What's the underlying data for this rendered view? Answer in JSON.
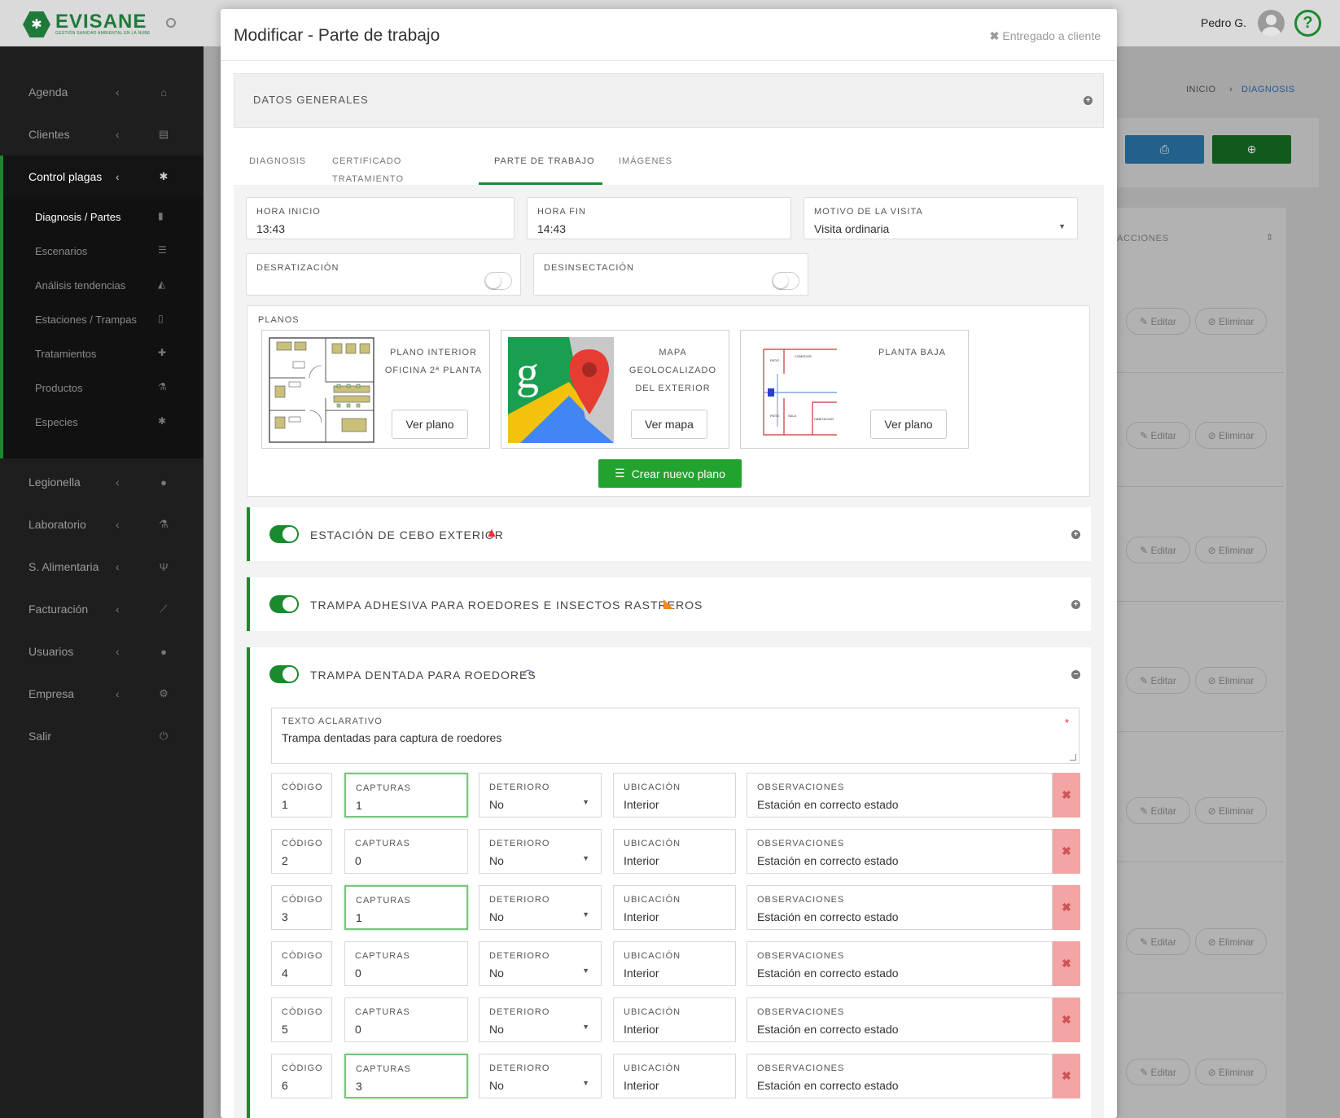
{
  "app": {
    "logo": "EVISANE",
    "logo_sub": "GESTIÓN SANIDAD AMBIENTAL EN LA NUBE",
    "user_name": "Pedro G.",
    "help": "?"
  },
  "sidebar": {
    "items": [
      {
        "label": "Agenda",
        "icon": "home-icon"
      },
      {
        "label": "Clientes",
        "icon": "id-card-icon"
      },
      {
        "label": "Control plagas",
        "icon": "bug-icon"
      },
      {
        "label": "Legionella",
        "icon": "drop-icon"
      },
      {
        "label": "Laboratorio",
        "icon": "flask-icon"
      },
      {
        "label": "S. Alimentaria",
        "icon": "cutlery-icon"
      },
      {
        "label": "Facturación",
        "icon": "chart-icon"
      },
      {
        "label": "Usuarios",
        "icon": "user-icon"
      },
      {
        "label": "Empresa",
        "icon": "gear-icon"
      },
      {
        "label": "Salir",
        "icon": "power-icon"
      }
    ],
    "sub_items": [
      {
        "label": "Diagnosis / Partes",
        "icon": "clipboard-icon"
      },
      {
        "label": "Escenarios",
        "icon": "list-icon"
      },
      {
        "label": "Análisis tendencias",
        "icon": "area-chart-icon"
      },
      {
        "label": "Estaciones / Trampas",
        "icon": "trash-icon"
      },
      {
        "label": "Tratamientos",
        "icon": "medkit-icon"
      },
      {
        "label": "Productos",
        "icon": "flask-icon"
      },
      {
        "label": "Especies",
        "icon": "bug-icon"
      }
    ]
  },
  "breadcrumb": {
    "home": "INICIO",
    "current": "DIAGNOSIS"
  },
  "background": {
    "column_header": "ACCIONES",
    "edit_label": "Editar",
    "delete_label": "Eliminar"
  },
  "modal": {
    "title": "Modificar - Parte de trabajo",
    "close_label": "Entregado a cliente",
    "general_section": "DATOS GENERALES",
    "tabs": [
      "DIAGNOSIS",
      "CERTIFICADO TRATAMIENTO",
      "PARTE DE TRABAJO",
      "IMÁGENES"
    ],
    "fields": {
      "hora_inicio": {
        "label": "HORA INICIO",
        "value": "13:43"
      },
      "hora_fin": {
        "label": "HORA FIN",
        "value": "14:43"
      },
      "motivo": {
        "label": "MOTIVO DE LA VISITA",
        "value": "Visita ordinaria"
      },
      "desratizacion": {
        "label": "DESRATIZACIÓN"
      },
      "desinsectacion": {
        "label": "DESINSECTACIÓN"
      }
    },
    "planos": {
      "label": "PLANOS",
      "cards": [
        {
          "line1": "PLANO INTERIOR",
          "line2": "OFICINA 2ª PLANTA",
          "line3": "",
          "button": "Ver plano"
        },
        {
          "line1": "MAPA",
          "line2": "GEOLOCALIZADO",
          "line3": "DEL EXTERIOR",
          "button": "Ver mapa"
        },
        {
          "line1": "PLANTA BAJA",
          "line2": "",
          "line3": "",
          "button": "Ver plano"
        }
      ],
      "create_button": "Crear nuevo plano"
    },
    "stations": [
      {
        "title": "ESTACIÓN DE CEBO EXTERIOR",
        "icon": "bait-station-icon",
        "color": "#e8313a"
      },
      {
        "title": "TRAMPA ADHESIVA PARA ROEDORES E INSECTOS RASTREROS",
        "icon": "sticky-trap-icon",
        "color": "#f28a1e"
      },
      {
        "title": "TRAMPA DENTADA PARA ROEDORES",
        "icon": "rodent-trap-icon",
        "color": "#9b3fb8"
      }
    ],
    "texto_aclarativo": {
      "label": "TEXTO ACLARATIVO",
      "value": "Trampa dentadas para captura de roedores",
      "required": "*"
    },
    "row_labels": {
      "codigo": "CÓDIGO",
      "capturas": "CAPTURAS",
      "deterioro": "DETERIORO",
      "ubicacion": "UBICACIÓN",
      "observaciones": "OBSERVACIONES"
    },
    "rows": [
      {
        "codigo": "1",
        "capturas": "1",
        "deterioro": "No",
        "ubicacion": "Interior",
        "observaciones": "Estación en correcto estado"
      },
      {
        "codigo": "2",
        "capturas": "0",
        "deterioro": "No",
        "ubicacion": "Interior",
        "observaciones": "Estación en correcto estado"
      },
      {
        "codigo": "3",
        "capturas": "1",
        "deterioro": "No",
        "ubicacion": "Interior",
        "observaciones": "Estación en correcto estado"
      },
      {
        "codigo": "4",
        "capturas": "0",
        "deterioro": "No",
        "ubicacion": "Interior",
        "observaciones": "Estación en correcto estado"
      },
      {
        "codigo": "5",
        "capturas": "0",
        "deterioro": "No",
        "ubicacion": "Interior",
        "observaciones": "Estación en correcto estado"
      },
      {
        "codigo": "6",
        "capturas": "3",
        "deterioro": "No",
        "ubicacion": "Interior",
        "observaciones": "Estación en correcto estado"
      }
    ]
  },
  "colors": {
    "brand_green": "#1b8a2e",
    "button_green": "#22a32f",
    "delete_red": "#f3a4a4"
  }
}
